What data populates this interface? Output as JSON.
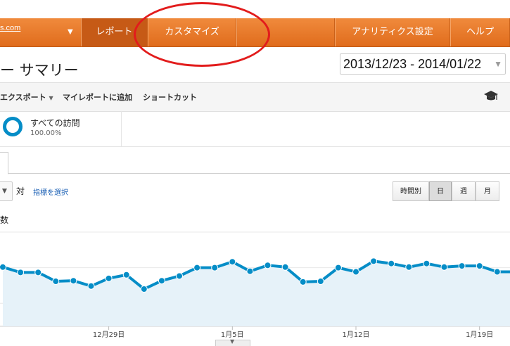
{
  "nav": {
    "account_text": "s.com",
    "tabs": [
      {
        "label": "レポート",
        "active": true
      },
      {
        "label": "カスタマイズ",
        "active": false
      },
      {
        "label": "",
        "active": false
      },
      {
        "label": "アナリティクス設定",
        "active": false
      },
      {
        "label": "ヘルプ",
        "active": false
      }
    ]
  },
  "title": "ー サマリー",
  "date_range": "2013/12/23 - 2014/01/22",
  "toolbar": {
    "export": "エクスポート",
    "add_to_dashboard": "マイレポートに追加",
    "shortcut": "ショートカット"
  },
  "segment": {
    "name": "すべての訪問",
    "percent": "100.00%"
  },
  "metric_row": {
    "vs": "対",
    "select_metric": "指標を選択",
    "periods": [
      {
        "label": "時間別",
        "selected": false
      },
      {
        "label": "日",
        "selected": true
      },
      {
        "label": "週",
        "selected": false
      },
      {
        "label": "月",
        "selected": false
      }
    ]
  },
  "metric_label": "数",
  "colors": {
    "nav_orange": "#e8782a",
    "line_blue": "#058dc7",
    "area_fill": "#e6f2f9",
    "annotation_red": "#e21c1c"
  },
  "chart_data": {
    "type": "area",
    "x": [
      "2013-12-23",
      "2013-12-24",
      "2013-12-25",
      "2013-12-26",
      "2013-12-27",
      "2013-12-28",
      "2013-12-29",
      "2013-12-30",
      "2013-12-31",
      "2014-01-01",
      "2014-01-02",
      "2014-01-03",
      "2014-01-04",
      "2014-01-05",
      "2014-01-06",
      "2014-01-07",
      "2014-01-08",
      "2014-01-09",
      "2014-01-10",
      "2014-01-11",
      "2014-01-12",
      "2014-01-13",
      "2014-01-14",
      "2014-01-15",
      "2014-01-16",
      "2014-01-17",
      "2014-01-18",
      "2014-01-19",
      "2014-01-20",
      "2014-01-21",
      "2014-01-22"
    ],
    "series": [
      {
        "values": [
          61,
          52,
          52,
          37,
          38,
          29,
          42,
          48,
          24,
          38,
          46,
          60,
          60,
          70,
          54,
          64,
          61,
          36,
          37,
          60,
          53,
          71,
          67,
          61,
          67,
          61,
          63,
          63,
          53,
          53,
          53
        ]
      }
    ],
    "x_tick_labels": [
      {
        "index": 6,
        "label": "12月29日"
      },
      {
        "index": 13,
        "label": "1月5日"
      },
      {
        "index": 20,
        "label": "1月12日"
      },
      {
        "index": 27,
        "label": "1月19日"
      }
    ],
    "ylim": [
      -40,
      120
    ],
    "grid": true
  }
}
